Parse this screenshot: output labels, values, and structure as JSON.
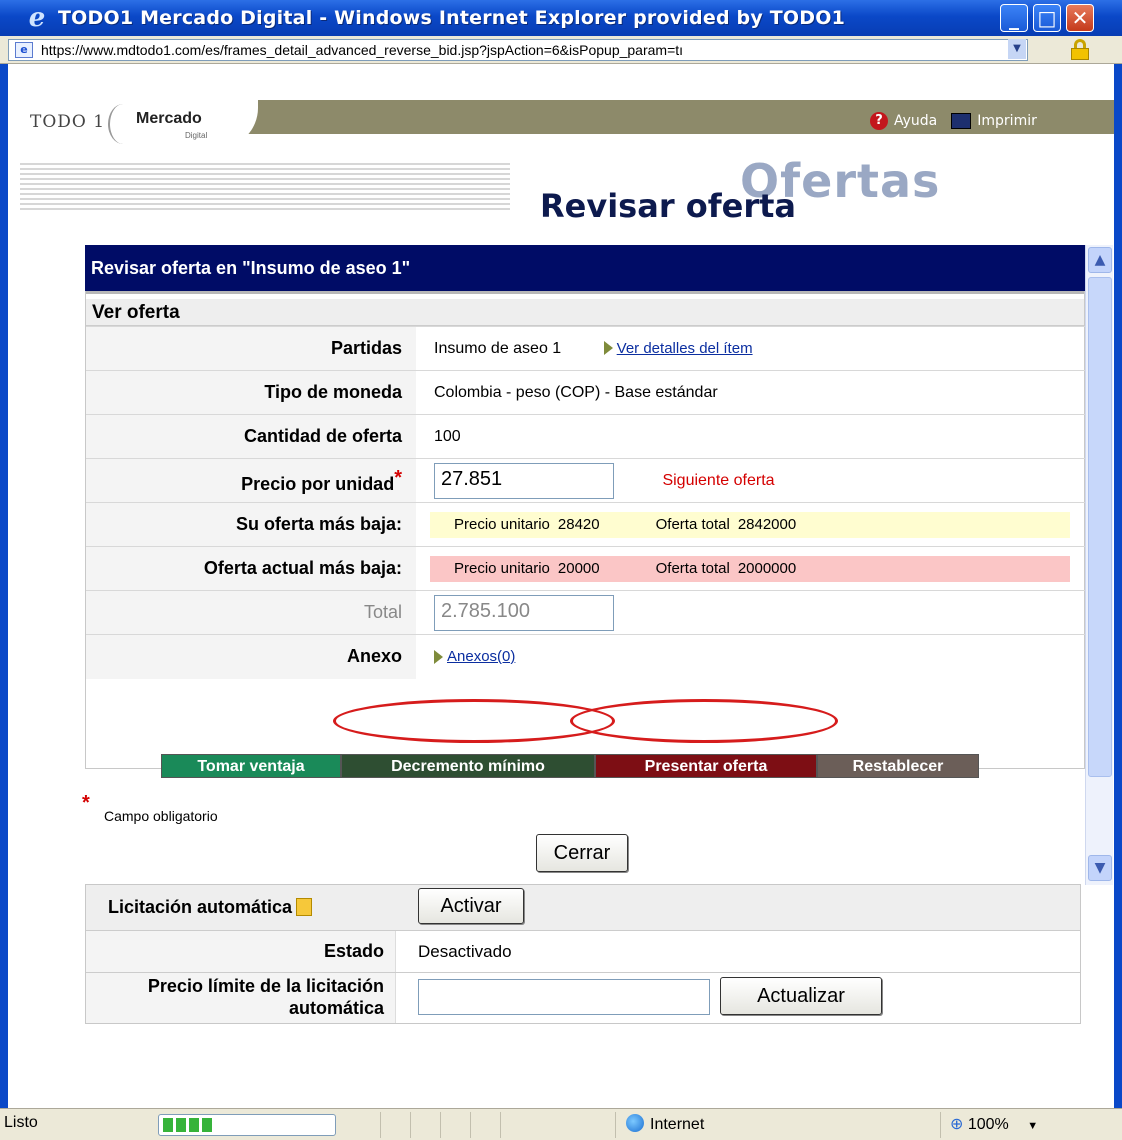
{
  "window": {
    "title": "TODO1 Mercado Digital - Windows Internet Explorer provided by TODO1",
    "url": "https://www.mdtodo1.com/es/frames_detail_advanced_reverse_bid.jsp?jspAction=6&isPopup_param=tı"
  },
  "app": {
    "logo_todo": "TODO 1",
    "logo_mercado": "Mercado",
    "logo_digital": "Digital",
    "help_label": "Ayuda",
    "print_label": "Imprimir",
    "section_watermark": "Ofertas",
    "page_title": "Revisar oferta"
  },
  "panel": {
    "header": "Revisar oferta en \"Insumo de aseo 1\"",
    "section_title": "Ver oferta",
    "rows": {
      "partidas_label": "Partidas",
      "partidas_value": "Insumo de aseo 1",
      "partidas_link": "Ver detalles del ítem",
      "moneda_label": "Tipo de moneda",
      "moneda_value": "Colombia - peso (COP) - Base estándar",
      "cantidad_label": "Cantidad de oferta",
      "cantidad_value": "100",
      "precio_label": "Precio por unidad",
      "precio_value": "27.851",
      "siguiente": "Siguiente oferta",
      "su_label": "Su oferta más baja:",
      "su_pu_label": "Precio unitario",
      "su_pu_value": "28420",
      "su_total_label": "Oferta total",
      "su_total_value": "2842000",
      "actual_label": "Oferta actual más baja:",
      "actual_pu_label": "Precio unitario",
      "actual_pu_value": "20000",
      "actual_total_label": "Oferta total",
      "actual_total_value": "2000000",
      "total_label": "Total",
      "total_value": "2.785.100",
      "anexo_label": "Anexo",
      "anexo_link": "Anexos(0)"
    },
    "buttons": {
      "tomar": "Tomar ventaja",
      "decremento": "Decremento mínimo",
      "presentar": "Presentar oferta",
      "restablecer": "Restablecer"
    }
  },
  "required_note": "Campo obligatorio",
  "close_button": "Cerrar",
  "auto_bid": {
    "title": "Licitación automática",
    "activate_button": "Activar",
    "estado_label": "Estado",
    "estado_value": "Desactivado",
    "limit_label": "Precio límite de la licitación automática",
    "update_button": "Actualizar"
  },
  "statusbar": {
    "status": "Listo",
    "zone": "Internet",
    "zoom": "100%",
    "progress": 0.3
  },
  "colors": {
    "panel_header": "#000c66",
    "yellow_bar": "#fffdd0",
    "pink_bar": "#fbc6c6",
    "highlight_ellipse": "#d61c1c"
  }
}
